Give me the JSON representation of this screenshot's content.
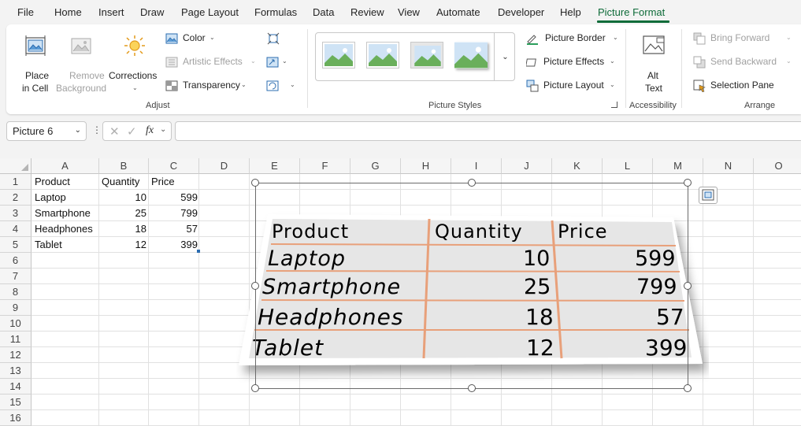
{
  "menu": {
    "tabs": [
      "File",
      "Home",
      "Insert",
      "Draw",
      "Page Layout",
      "Formulas",
      "Data",
      "Review",
      "View",
      "Automate",
      "Developer",
      "Help",
      "Picture Format"
    ],
    "active": "Picture Format"
  },
  "ribbon": {
    "adjust": {
      "place_in_cell_1": "Place",
      "place_in_cell_2": "in Cell",
      "remove_bg_1": "Remove",
      "remove_bg_2": "Background",
      "corrections": "Corrections",
      "color": "Color",
      "artistic_effects": "Artistic Effects",
      "transparency": "Transparency",
      "label": "Adjust"
    },
    "styles": {
      "picture_border": "Picture Border",
      "picture_effects": "Picture Effects",
      "picture_layout": "Picture Layout",
      "label": "Picture Styles"
    },
    "accessibility": {
      "alt_text_1": "Alt",
      "alt_text_2": "Text",
      "label": "Accessibility"
    },
    "arrange": {
      "bring_forward": "Bring Forward",
      "send_backward": "Send Backward",
      "selection_pane": "Selection Pane",
      "label": "Arrange"
    }
  },
  "formula_bar": {
    "name_box": "Picture 6",
    "fx": "fx",
    "value": ""
  },
  "sheet": {
    "columns": [
      "A",
      "B",
      "C",
      "D",
      "E",
      "F",
      "G",
      "H",
      "I",
      "J",
      "K",
      "L",
      "M",
      "N",
      "O"
    ],
    "rows": [
      "1",
      "2",
      "3",
      "4",
      "5",
      "6",
      "7",
      "8",
      "9",
      "10",
      "11",
      "12",
      "13",
      "14",
      "15",
      "16"
    ],
    "headers": [
      "Product",
      "Quantity",
      "Price"
    ],
    "data": [
      [
        "Laptop",
        "10",
        "599"
      ],
      [
        "Smartphone",
        "25",
        "799"
      ],
      [
        "Headphones",
        "18",
        "57"
      ],
      [
        "Tablet",
        "12",
        "399"
      ]
    ]
  },
  "picture": {
    "headers": [
      "Product",
      "Quantity",
      "Price"
    ],
    "rows": [
      [
        "Laptop",
        "10",
        "599"
      ],
      [
        "Smartphone",
        "25",
        "799"
      ],
      [
        "Headphones",
        "18",
        "57"
      ],
      [
        "Tablet",
        "12",
        "399"
      ]
    ]
  },
  "colors": {
    "accent": "#0e6b39",
    "picture_line": "#e8a07a",
    "picture_fill": "#e6e6e6"
  }
}
